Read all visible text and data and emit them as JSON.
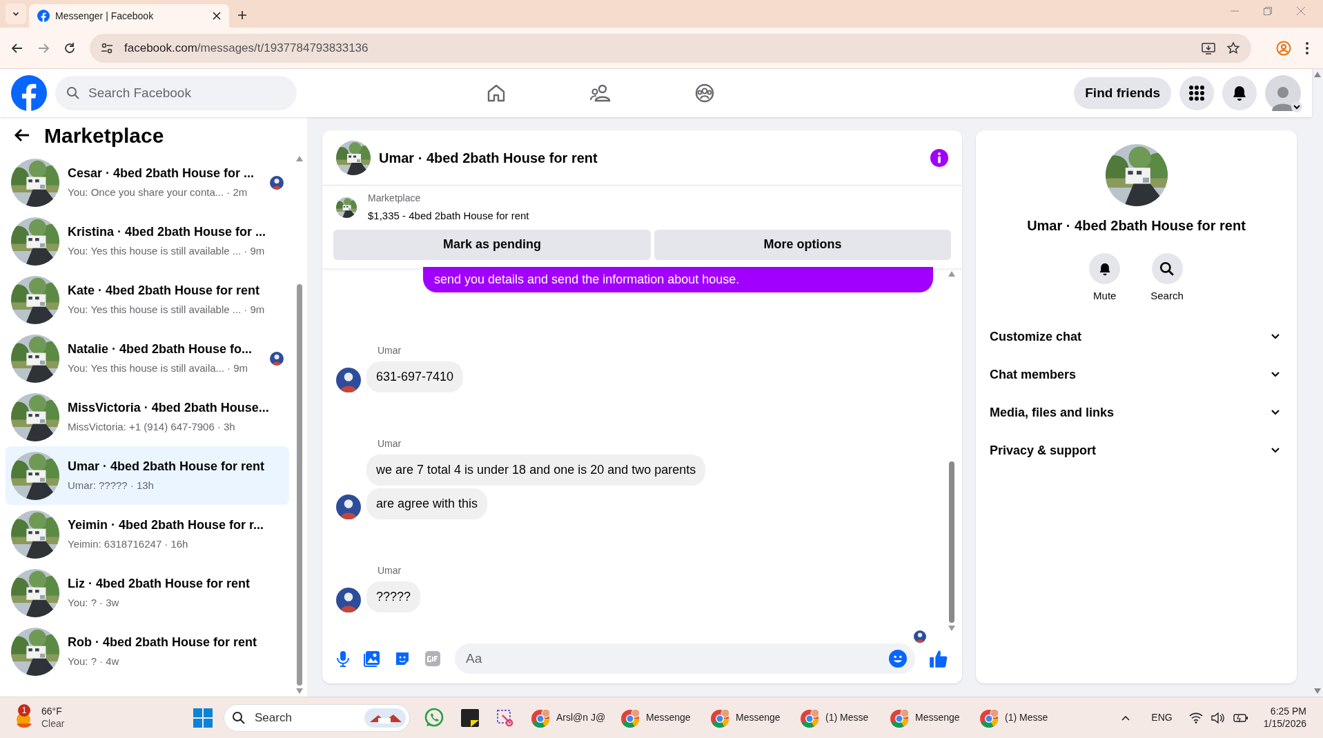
{
  "browser": {
    "tab_title": "Messenger | Facebook",
    "url_host": "facebook.com",
    "url_path": "/messages/t/1937784793833136"
  },
  "header": {
    "search_placeholder": "Search Facebook",
    "find_friends": "Find friends"
  },
  "sidebar": {
    "title": "Marketplace",
    "conversations": [
      {
        "name": "Cesar · 4bed 2bath House for ...",
        "preview": "You: Once you share your conta...",
        "time": "· 2m",
        "selected": false,
        "seen": true
      },
      {
        "name": "Kristina · 4bed 2bath House for ...",
        "preview": "You: Yes this house is still available ...",
        "time": "· 9m",
        "selected": false,
        "seen": false
      },
      {
        "name": "Kate · 4bed 2bath House for rent",
        "preview": "You: Yes this house is still available ...",
        "time": "· 9m",
        "selected": false,
        "seen": false
      },
      {
        "name": "Natalie · 4bed 2bath House fo...",
        "preview": "You: Yes this house is still availa...",
        "time": "· 9m",
        "selected": false,
        "seen": true
      },
      {
        "name": "MissVictoria · 4bed 2bath House...",
        "preview": "MissVictoria: +1 (914) 647-7906",
        "time": "· 3h",
        "selected": false,
        "seen": false
      },
      {
        "name": "Umar · 4bed 2bath House for rent",
        "preview": "Umar: ?????",
        "time": "· 13h",
        "selected": true,
        "seen": false
      },
      {
        "name": "Yeimin · 4bed 2bath House for r...",
        "preview": "Yeimin: 6318716247",
        "time": "· 16h",
        "selected": false,
        "seen": false
      },
      {
        "name": "Liz · 4bed 2bath House for rent",
        "preview": "You: ?",
        "time": "· 3w",
        "selected": false,
        "seen": false
      },
      {
        "name": "Rob · 4bed 2bath House for rent",
        "preview": "You: ?",
        "time": "· 4w",
        "selected": false,
        "seen": false
      }
    ]
  },
  "chat": {
    "title": "Umar · 4bed 2bath House for rent",
    "listing": {
      "label": "Marketplace",
      "title": "$1,335 - 4bed 2bath House for rent"
    },
    "buttons": [
      "Mark as pending",
      "More options"
    ],
    "messages": [
      {
        "kind": "outgoing",
        "text": "send you details and send the information about house."
      },
      {
        "kind": "incoming",
        "sender": "Umar",
        "bubbles": [
          "631-697-7410"
        ]
      },
      {
        "kind": "incoming",
        "sender": "Umar",
        "bubbles": [
          "we are 7 total 4 is under 18 and one is 20 and two parents",
          "are agree with this"
        ]
      },
      {
        "kind": "incoming",
        "sender": "Umar",
        "bubbles": [
          "?????"
        ]
      }
    ],
    "composer_placeholder": "Aa"
  },
  "info": {
    "title": "Umar · 4bed 2bath House for rent",
    "actions": [
      {
        "kind": "mute",
        "label": "Mute"
      },
      {
        "kind": "search",
        "label": "Search"
      }
    ],
    "sections": [
      {
        "label": "Customize chat",
        "expanded": false
      },
      {
        "label": "Chat members",
        "expanded": false
      },
      {
        "label": "Media, files and links",
        "expanded": false
      },
      {
        "label": "Privacy & support",
        "expanded": false
      }
    ]
  },
  "taskbar": {
    "weather": {
      "badge": "1",
      "temp": "66°F",
      "condition": "Clear"
    },
    "search_placeholder": "Search",
    "windows": [
      {
        "label": "Arsl@n J@"
      },
      {
        "label": "Messenge"
      },
      {
        "label": "Messenge"
      },
      {
        "label": "(1) Messe"
      },
      {
        "label": "Messenge"
      },
      {
        "label": "(1) Messe"
      }
    ],
    "language": "ENG",
    "time": "6:25 PM",
    "date": "1/15/2026"
  }
}
